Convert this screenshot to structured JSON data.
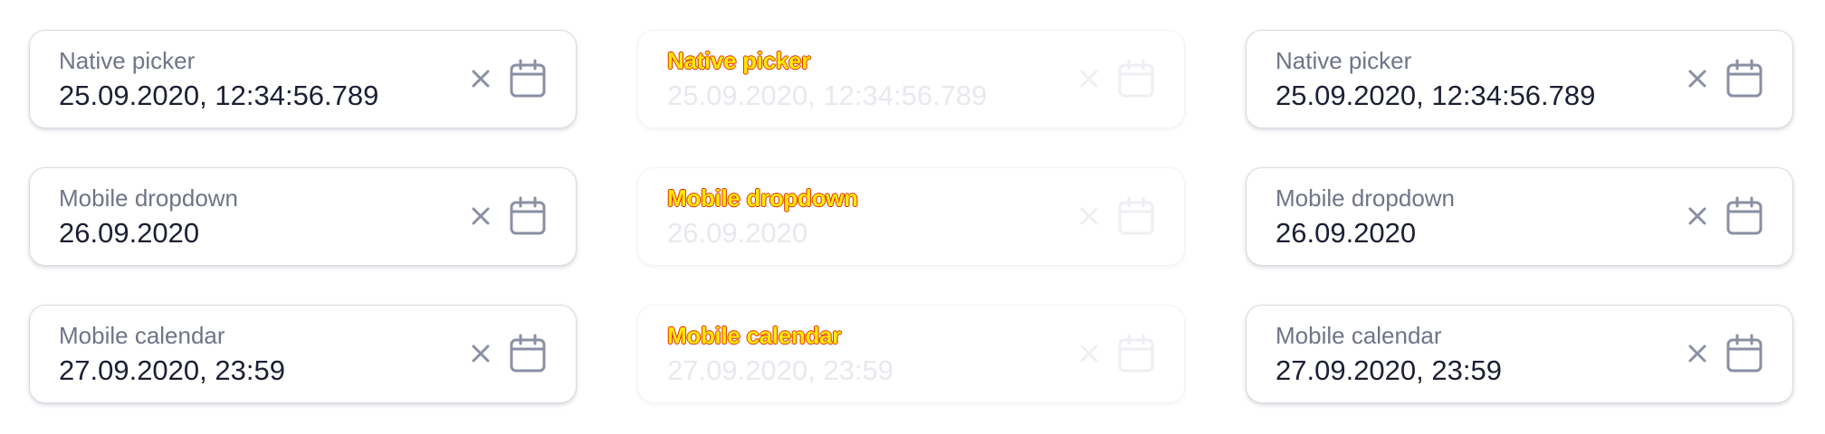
{
  "panels": [
    {
      "state": "enabled",
      "fields": [
        {
          "label": "Native picker",
          "value": "25.09.2020, 12:34:56.789",
          "clear_icon": "close-icon",
          "calendar_icon": "calendar-icon"
        },
        {
          "label": "Mobile dropdown",
          "value": "26.09.2020",
          "clear_icon": "close-icon",
          "calendar_icon": "calendar-icon"
        },
        {
          "label": "Mobile calendar",
          "value": "27.09.2020, 23:59",
          "clear_icon": "close-icon",
          "calendar_icon": "calendar-icon"
        }
      ]
    },
    {
      "state": "disabled",
      "fields": [
        {
          "label": "Native picker",
          "value": "25.09.2020, 12:34:56.789",
          "clear_icon": "close-icon",
          "calendar_icon": "calendar-icon"
        },
        {
          "label": "Mobile dropdown",
          "value": "26.09.2020",
          "clear_icon": "close-icon",
          "calendar_icon": "calendar-icon"
        },
        {
          "label": "Mobile calendar",
          "value": "27.09.2020, 23:59",
          "clear_icon": "close-icon",
          "calendar_icon": "calendar-icon"
        }
      ]
    },
    {
      "state": "enabled",
      "fields": [
        {
          "label": "Native picker",
          "value": "25.09.2020, 12:34:56.789",
          "clear_icon": "close-icon",
          "calendar_icon": "calendar-icon"
        },
        {
          "label": "Mobile dropdown",
          "value": "26.09.2020",
          "clear_icon": "close-icon",
          "calendar_icon": "calendar-icon"
        },
        {
          "label": "Mobile calendar",
          "value": "27.09.2020, 23:59",
          "clear_icon": "close-icon",
          "calendar_icon": "calendar-icon"
        }
      ]
    }
  ],
  "colors": {
    "label": "#6f7488",
    "value": "#1c1f33",
    "icon": "#8a8fa3",
    "border": "#d9dbe3",
    "disabled_label_fill": "#ffea00",
    "disabled_label_outline": "#e03000"
  }
}
